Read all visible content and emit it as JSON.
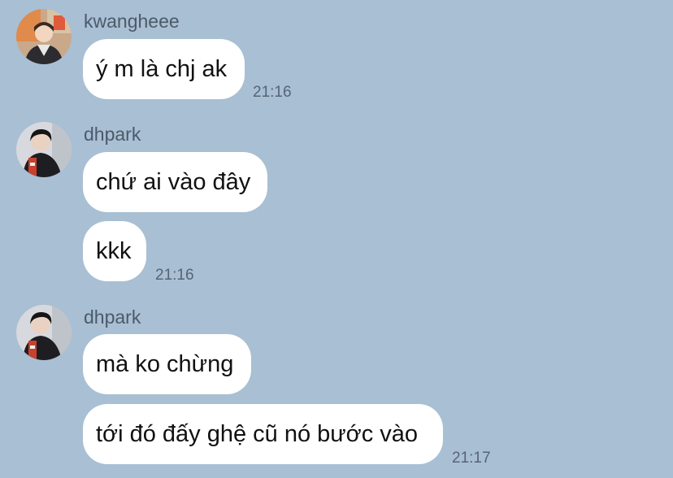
{
  "messages": [
    {
      "sender": "kwangheee",
      "avatar": "kwangheee-avatar",
      "bubbles": [
        "ý m là chj ak"
      ],
      "time": "21:16"
    },
    {
      "sender": "dhpark",
      "avatar": "dhpark-avatar",
      "bubbles": [
        "chứ ai vào đây",
        "kkk"
      ],
      "time": "21:16"
    },
    {
      "sender": "dhpark",
      "avatar": "dhpark-avatar",
      "bubbles": [
        "mà ko chừng",
        "tới đó đấy ghệ cũ nó bước vào"
      ],
      "time": "21:17"
    }
  ],
  "colors": {
    "background": "#a9bfd3",
    "bubble": "#ffffff",
    "sender_text": "#4b5a6a",
    "time_text": "#566575"
  }
}
